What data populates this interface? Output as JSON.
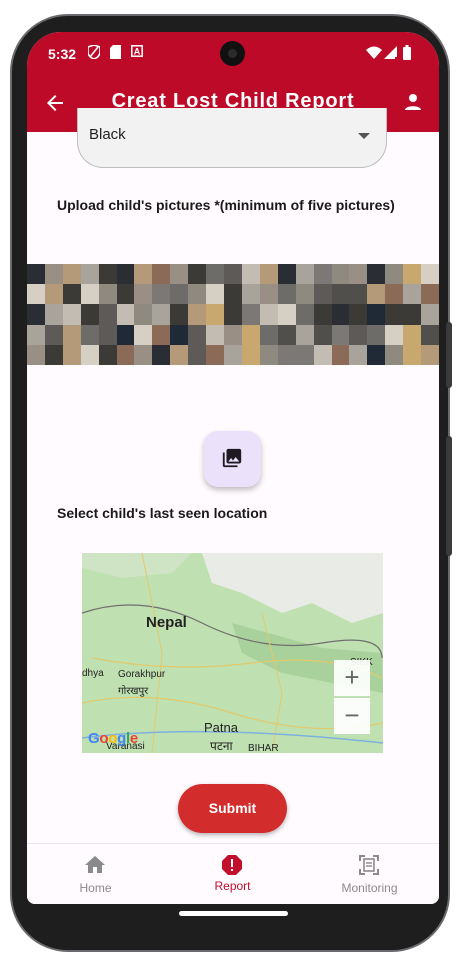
{
  "status_bar": {
    "time": "5:32"
  },
  "app_bar": {
    "title": "Creat Lost Child Report",
    "back_icon": "arrow-back-icon",
    "profile_icon": "person-icon"
  },
  "form": {
    "dropdown_value": "Black",
    "upload_label": "Upload child's pictures *(minimum of five pictures)",
    "location_label": "Select child's last seen location",
    "submit_label": "Submit"
  },
  "map": {
    "labels": {
      "nepal": "Nepal",
      "odhya": "dhya",
      "gorakhpur": "Gorakhpur",
      "gorakhpur_hi": "गोरखपुर",
      "patna": "Patna",
      "patna_hi": "पटना",
      "varanasi": "Varanasi",
      "bihar": "BIHAR",
      "sikkim": "SIKK",
      "google": "Google"
    },
    "zoom_in": "+",
    "zoom_out": "−"
  },
  "bottom_nav": {
    "items": [
      {
        "label": "Home",
        "icon": "home-icon",
        "active": false
      },
      {
        "label": "Report",
        "icon": "report-icon",
        "active": true
      },
      {
        "label": "Monitoring",
        "icon": "monitoring-icon",
        "active": false
      }
    ]
  },
  "colors": {
    "accent": "#bd0a29",
    "submit": "#d32c2c",
    "active_nav": "#c2102c"
  }
}
